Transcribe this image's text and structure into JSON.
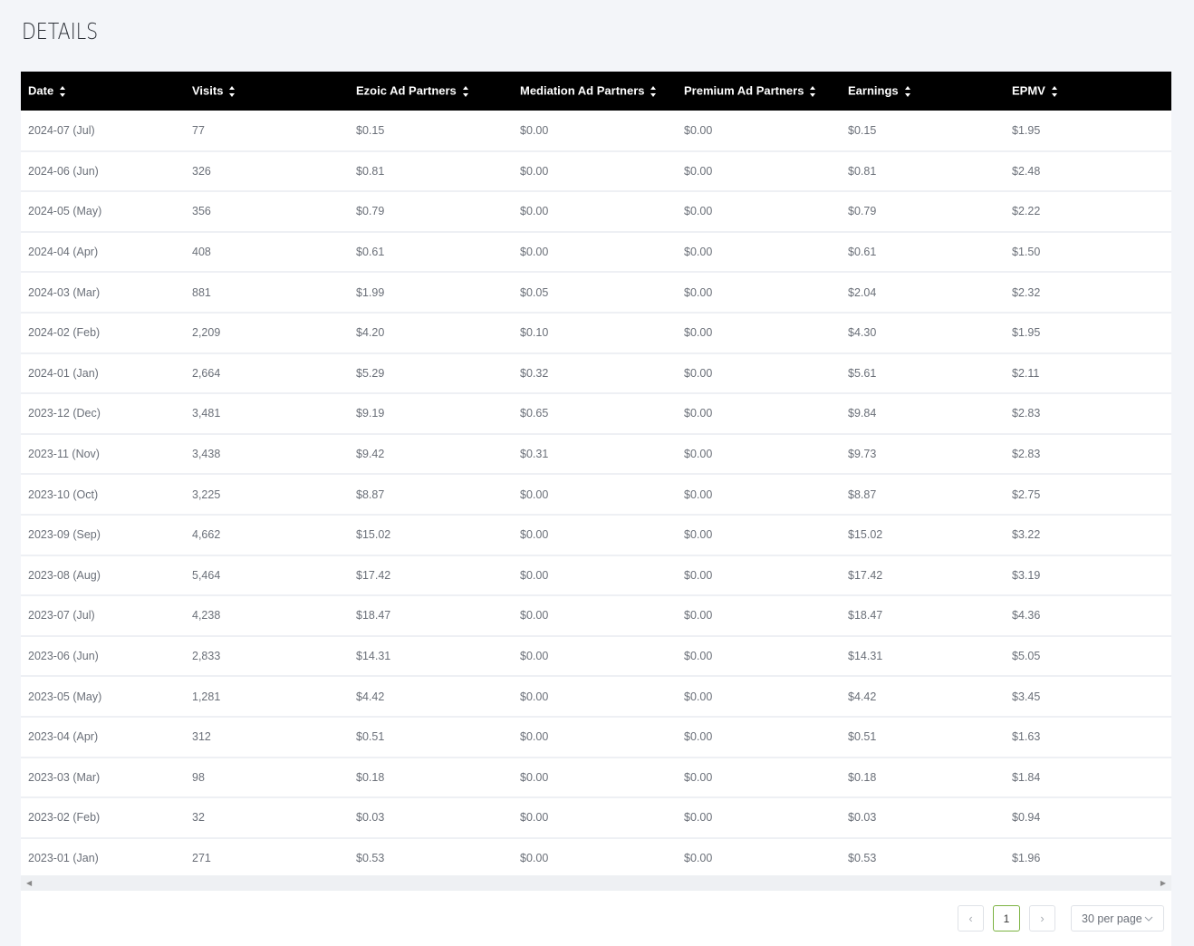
{
  "page": {
    "title": "DETAILS"
  },
  "table": {
    "columns": [
      {
        "label": "Date"
      },
      {
        "label": "Visits"
      },
      {
        "label": "Ezoic Ad Partners"
      },
      {
        "label": "Mediation Ad Partners"
      },
      {
        "label": "Premium Ad Partners"
      },
      {
        "label": "Earnings"
      },
      {
        "label": "EPMV"
      }
    ],
    "rows": [
      [
        "2024-07 (Jul)",
        "77",
        "$0.15",
        "$0.00",
        "$0.00",
        "$0.15",
        "$1.95"
      ],
      [
        "2024-06 (Jun)",
        "326",
        "$0.81",
        "$0.00",
        "$0.00",
        "$0.81",
        "$2.48"
      ],
      [
        "2024-05 (May)",
        "356",
        "$0.79",
        "$0.00",
        "$0.00",
        "$0.79",
        "$2.22"
      ],
      [
        "2024-04 (Apr)",
        "408",
        "$0.61",
        "$0.00",
        "$0.00",
        "$0.61",
        "$1.50"
      ],
      [
        "2024-03 (Mar)",
        "881",
        "$1.99",
        "$0.05",
        "$0.00",
        "$2.04",
        "$2.32"
      ],
      [
        "2024-02 (Feb)",
        "2,209",
        "$4.20",
        "$0.10",
        "$0.00",
        "$4.30",
        "$1.95"
      ],
      [
        "2024-01 (Jan)",
        "2,664",
        "$5.29",
        "$0.32",
        "$0.00",
        "$5.61",
        "$2.11"
      ],
      [
        "2023-12 (Dec)",
        "3,481",
        "$9.19",
        "$0.65",
        "$0.00",
        "$9.84",
        "$2.83"
      ],
      [
        "2023-11 (Nov)",
        "3,438",
        "$9.42",
        "$0.31",
        "$0.00",
        "$9.73",
        "$2.83"
      ],
      [
        "2023-10 (Oct)",
        "3,225",
        "$8.87",
        "$0.00",
        "$0.00",
        "$8.87",
        "$2.75"
      ],
      [
        "2023-09 (Sep)",
        "4,662",
        "$15.02",
        "$0.00",
        "$0.00",
        "$15.02",
        "$3.22"
      ],
      [
        "2023-08 (Aug)",
        "5,464",
        "$17.42",
        "$0.00",
        "$0.00",
        "$17.42",
        "$3.19"
      ],
      [
        "2023-07 (Jul)",
        "4,238",
        "$18.47",
        "$0.00",
        "$0.00",
        "$18.47",
        "$4.36"
      ],
      [
        "2023-06 (Jun)",
        "2,833",
        "$14.31",
        "$0.00",
        "$0.00",
        "$14.31",
        "$5.05"
      ],
      [
        "2023-05 (May)",
        "1,281",
        "$4.42",
        "$0.00",
        "$0.00",
        "$4.42",
        "$3.45"
      ],
      [
        "2023-04 (Apr)",
        "312",
        "$0.51",
        "$0.00",
        "$0.00",
        "$0.51",
        "$1.63"
      ],
      [
        "2023-03 (Mar)",
        "98",
        "$0.18",
        "$0.00",
        "$0.00",
        "$0.18",
        "$1.84"
      ],
      [
        "2023-02 (Feb)",
        "32",
        "$0.03",
        "$0.00",
        "$0.00",
        "$0.03",
        "$0.94"
      ],
      [
        "2023-01 (Jan)",
        "271",
        "$0.53",
        "$0.00",
        "$0.00",
        "$0.53",
        "$1.96"
      ]
    ]
  },
  "pagination": {
    "prev_glyph": "‹",
    "current_page": "1",
    "next_glyph": "›",
    "per_page": "30 per page"
  },
  "icons": {
    "sort": "sort-icon",
    "chevron": "chevron-down-icon",
    "scroll_left": "scroll-left-icon",
    "scroll_right": "scroll-right-icon"
  },
  "colors": {
    "header_bg": "#000000",
    "active_page_border": "#7cb342",
    "page_bg": "#f3f5f9"
  }
}
